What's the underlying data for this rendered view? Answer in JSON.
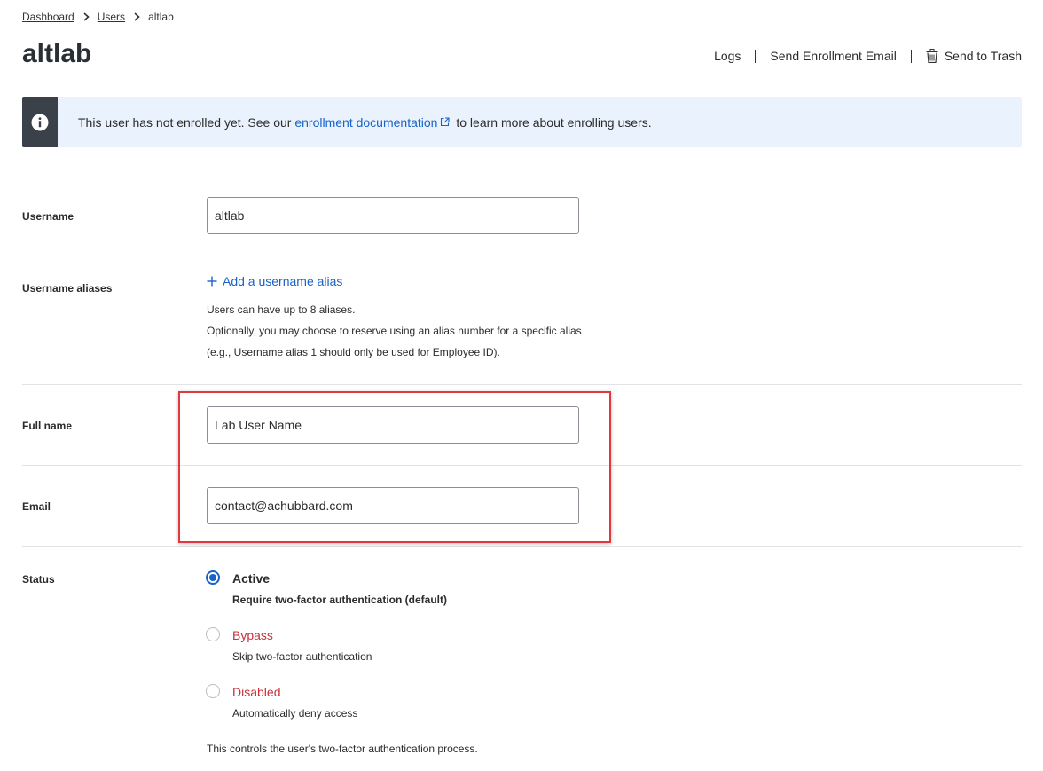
{
  "breadcrumb": {
    "items": [
      "Dashboard",
      "Users"
    ],
    "current": "altlab"
  },
  "page_title": "altlab",
  "header_actions": {
    "logs": "Logs",
    "send_enrollment": "Send Enrollment Email",
    "send_trash": "Send to Trash"
  },
  "banner": {
    "text_before": "This user has not enrolled yet. See our ",
    "link_text": "enrollment documentation",
    "text_after": " to learn more about enrolling users.",
    "icon": "info-icon"
  },
  "form": {
    "username": {
      "label": "Username",
      "value": "altlab"
    },
    "aliases": {
      "label": "Username aliases",
      "add_link": "Add a username alias",
      "help": [
        "Users can have up to 8 aliases.",
        "Optionally, you may choose to reserve using an alias number for a specific alias",
        "(e.g., Username alias 1 should only be used for Employee ID)."
      ]
    },
    "full_name": {
      "label": "Full name",
      "value": "Lab User Name"
    },
    "email": {
      "label": "Email",
      "value": "contact@achubbard.com"
    },
    "status": {
      "label": "Status",
      "selected": "Active",
      "options": [
        {
          "title": "Active",
          "desc": "Require two-factor authentication (default)"
        },
        {
          "title": "Bypass",
          "desc": "Skip two-factor authentication"
        },
        {
          "title": "Disabled",
          "desc": "Automatically deny access"
        }
      ],
      "footer": "This controls the user's two-factor authentication process."
    }
  },
  "colors": {
    "link": "#1a62c7",
    "danger": "#c7313a",
    "highlight": "#e0383f",
    "banner_bg": "#eaf3fd"
  }
}
